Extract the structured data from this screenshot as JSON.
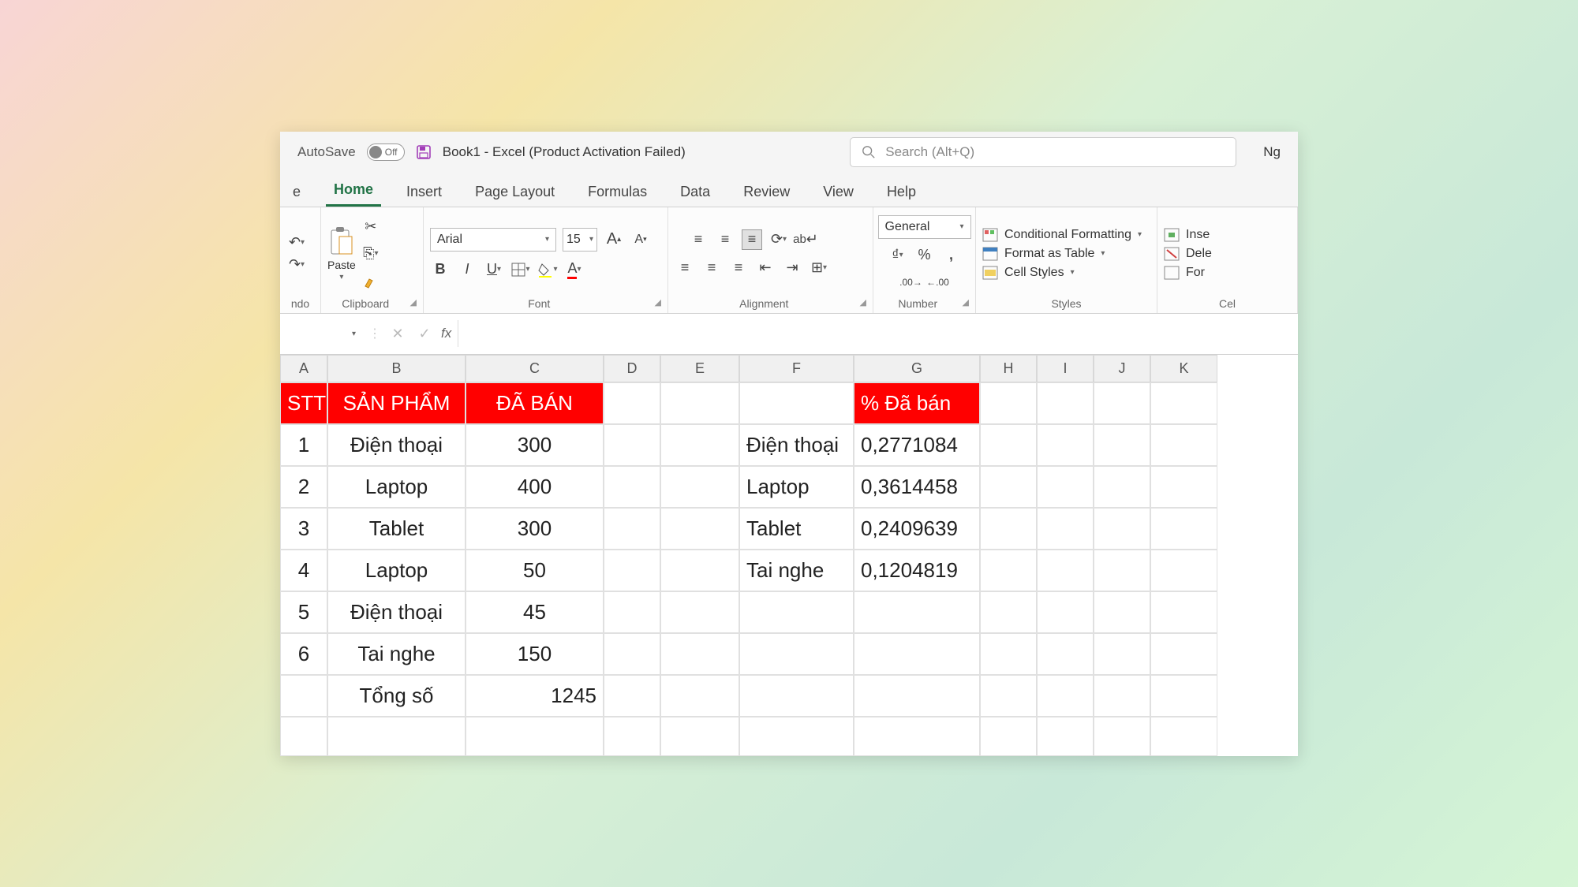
{
  "titlebar": {
    "autosave": "AutoSave",
    "toggle_off": "Off",
    "title": "Book1  -  Excel (Product Activation Failed)",
    "search_ph": "Search (Alt+Q)",
    "user": "Ng"
  },
  "tabs": {
    "file": "e",
    "home": "Home",
    "insert": "Insert",
    "pagelayout": "Page Layout",
    "formulas": "Formulas",
    "data": "Data",
    "review": "Review",
    "view": "View",
    "help": "Help"
  },
  "ribbon": {
    "undo": "ndo",
    "clipboard": "Clipboard",
    "paste": "Paste",
    "font": "Font",
    "font_name": "Arial",
    "font_size": "15",
    "alignment": "Alignment",
    "number": "Number",
    "number_format": "General",
    "styles": "Styles",
    "cf": "Conditional Formatting",
    "fat": "Format as Table",
    "cs": "Cell Styles",
    "cells": "Cel",
    "ins": "Inse",
    "del": "Dele",
    "for": "For"
  },
  "cols": [
    "A",
    "B",
    "C",
    "D",
    "E",
    "F",
    "G",
    "H",
    "I",
    "J",
    "K"
  ],
  "headers": {
    "stt": "STT",
    "sp": "SẢN PHẨM",
    "db": "ĐÃ BÁN",
    "pdb": "% Đã bán"
  },
  "rows": [
    {
      "stt": "1",
      "sp": "Điện thoại",
      "db": "300"
    },
    {
      "stt": "2",
      "sp": "Laptop",
      "db": "400"
    },
    {
      "stt": "3",
      "sp": "Tablet",
      "db": "300"
    },
    {
      "stt": "4",
      "sp": "Laptop",
      "db": "50"
    },
    {
      "stt": "5",
      "sp": "Điện thoại",
      "db": "45"
    },
    {
      "stt": "6",
      "sp": "Tai nghe",
      "db": "150"
    }
  ],
  "total": {
    "label": "Tổng số",
    "value": "1245"
  },
  "pct": [
    {
      "name": "Điện thoại",
      "val": "0,2771084"
    },
    {
      "name": "Laptop",
      "val": "0,3614458"
    },
    {
      "name": "Tablet",
      "val": "0,2409639"
    },
    {
      "name": "Tai nghe",
      "val": "0,1204819"
    }
  ]
}
